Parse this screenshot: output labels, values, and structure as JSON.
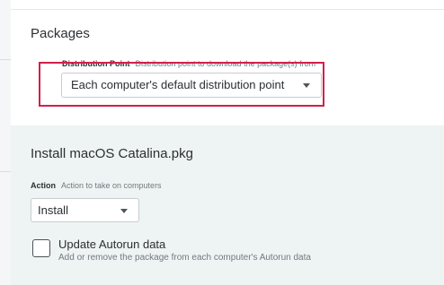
{
  "packages": {
    "title": "Packages",
    "distribution_point": {
      "label": "Distribution Point",
      "hint": "Distribution point to download the package(s) from",
      "selected": "Each computer's default distribution point"
    }
  },
  "package_item": {
    "title": "Install macOS Catalina.pkg",
    "action": {
      "label": "Action",
      "hint": "Action to take on computers",
      "selected": "Install"
    },
    "autorun": {
      "label": "Update Autorun data",
      "description": "Add or remove the package from each computer's Autorun data",
      "checked": false
    }
  },
  "colors": {
    "highlight": "#d0204d",
    "panel_background": "#eef3f3"
  },
  "icons": {
    "dropdown": "caret-down-icon",
    "checkbox": "checkbox-unchecked-icon"
  }
}
